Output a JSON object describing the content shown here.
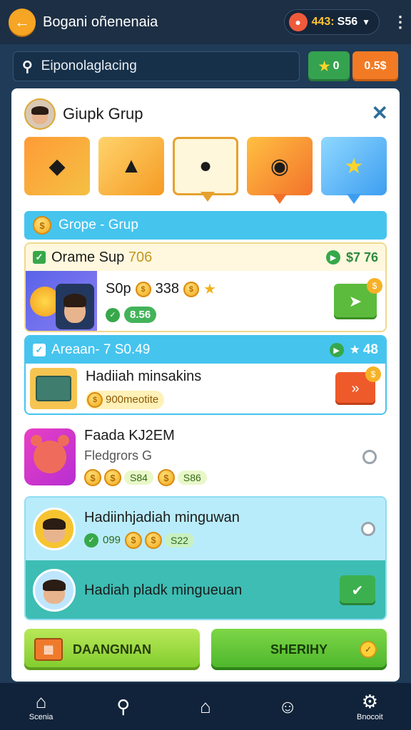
{
  "header": {
    "title": "Bogani oñenenaia",
    "currency_gold": "443:",
    "currency_white": "S56",
    "back_icon": "arrow-left-icon",
    "menu_icon": "kebab-icon"
  },
  "search": {
    "placeholder": "Eiponolaglacing",
    "star_value": "0",
    "orange_label": "0.5$"
  },
  "card": {
    "title": "Giupk Grup",
    "close_icon": "close-icon",
    "group_banner": "Grope - Grup",
    "section1": {
      "title": "Orame Sup",
      "title_extra": "706",
      "price": "$7 76",
      "row_text": "S0p",
      "row_value": "338",
      "pill_value": "8.56"
    },
    "section2": {
      "title": "Areaan- 7 S0.49",
      "score": "48",
      "item_title": "Hadiiah minsakins",
      "coin_text": "900meotite"
    },
    "item3": {
      "title": "Faada KJ2EM",
      "subtitle": "Fledgrors G",
      "val1": "S84",
      "val2": "S86"
    },
    "section4": {
      "top_title": "Hadiinhjadiah minguwan",
      "top_val1": "099",
      "top_val2": "S22",
      "bottom_title": "Hadiah pladk mingueuan"
    },
    "buttons": {
      "left_label": "DAANGNIAN",
      "right_label": "SHERIHY"
    }
  },
  "nav": {
    "items": [
      {
        "icon": "home-icon",
        "label": "Scenia"
      },
      {
        "icon": "search-icon",
        "label": ""
      },
      {
        "icon": "home-outline-icon",
        "label": ""
      },
      {
        "icon": "face-icon",
        "label": ""
      },
      {
        "icon": "gear-icon",
        "label": "Bnocoit"
      }
    ]
  },
  "colors": {
    "topbar": "#1d2f44",
    "background": "#1f3b57",
    "accent_blue": "#45c4ee",
    "accent_green": "#37a84a",
    "accent_orange": "#f27a24"
  }
}
